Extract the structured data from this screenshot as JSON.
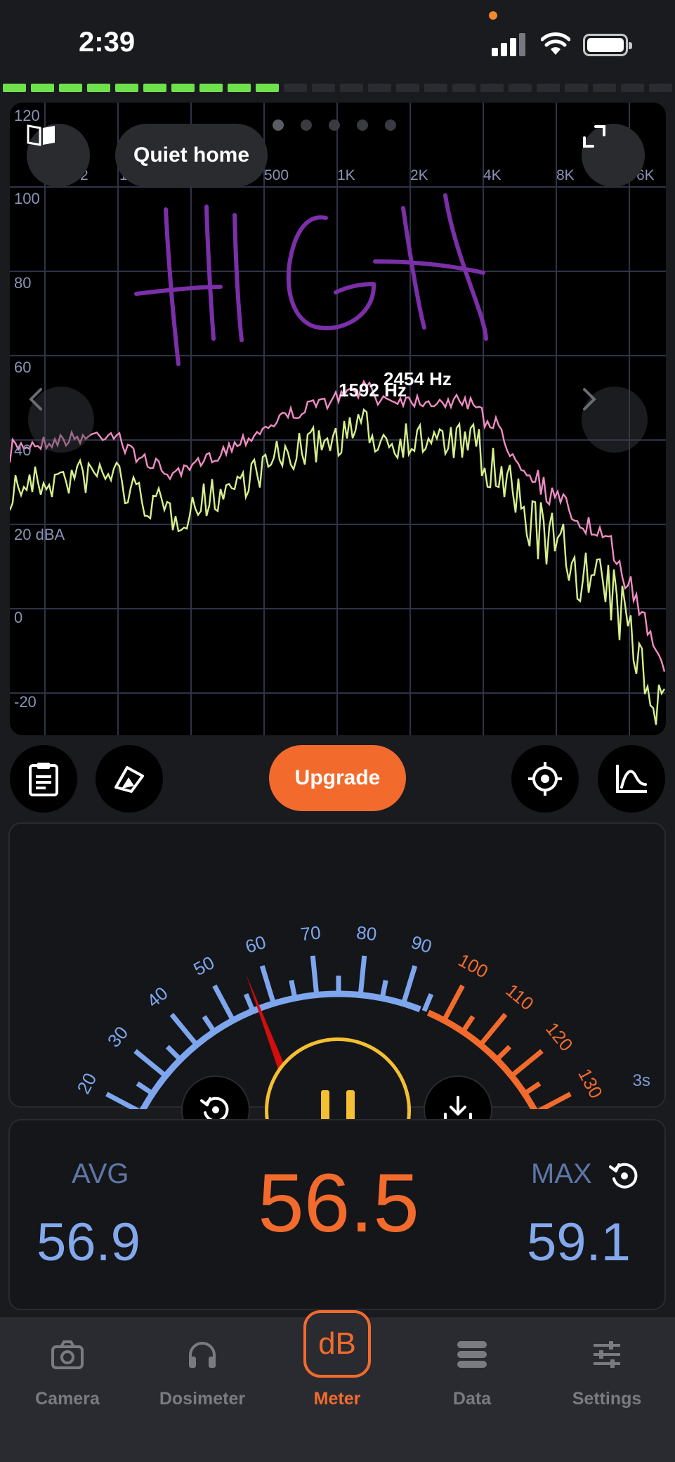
{
  "status_bar": {
    "time": "2:39"
  },
  "spectrum": {
    "y_axis_labels": [
      "120",
      "100",
      "80",
      "60",
      "40",
      "20 dBA",
      "0",
      "-20"
    ],
    "x_axis_labels": [
      "2",
      "1",
      "500",
      "1K",
      "2K",
      "4K",
      "8K",
      "6K"
    ],
    "peak_labels": [
      "1592 Hz",
      "2454 Hz"
    ],
    "mode_label": "Quiet home",
    "annotation": "HIGH",
    "colors": {
      "current": "#d6f08c",
      "peak": "#f08cc4",
      "grid": "#2e3347",
      "annotation": "#7b2fa8"
    }
  },
  "toolbar": {
    "upgrade_label": "Upgrade"
  },
  "gauge": {
    "scale": [
      "20",
      "30",
      "40",
      "50",
      "60",
      "70",
      "80",
      "90",
      "100",
      "110",
      "120",
      "130"
    ],
    "needle_value": 56.5,
    "duration": "3s",
    "colors": {
      "normal": "#7ea6ee",
      "loud": "#f26b2d",
      "needle": "#d40d0d"
    }
  },
  "readings": {
    "avg_label": "AVG",
    "avg_value": "56.9",
    "current_value": "56.5",
    "max_label": "MAX",
    "max_value": "59.1"
  },
  "nav": {
    "items": [
      {
        "label": "Camera",
        "icon": "camera-icon"
      },
      {
        "label": "Dosimeter",
        "icon": "headphones-icon"
      },
      {
        "label": "Meter",
        "icon": "db-icon"
      },
      {
        "label": "Data",
        "icon": "database-icon"
      },
      {
        "label": "Settings",
        "icon": "sliders-icon"
      }
    ],
    "meter_badge": "dB"
  }
}
